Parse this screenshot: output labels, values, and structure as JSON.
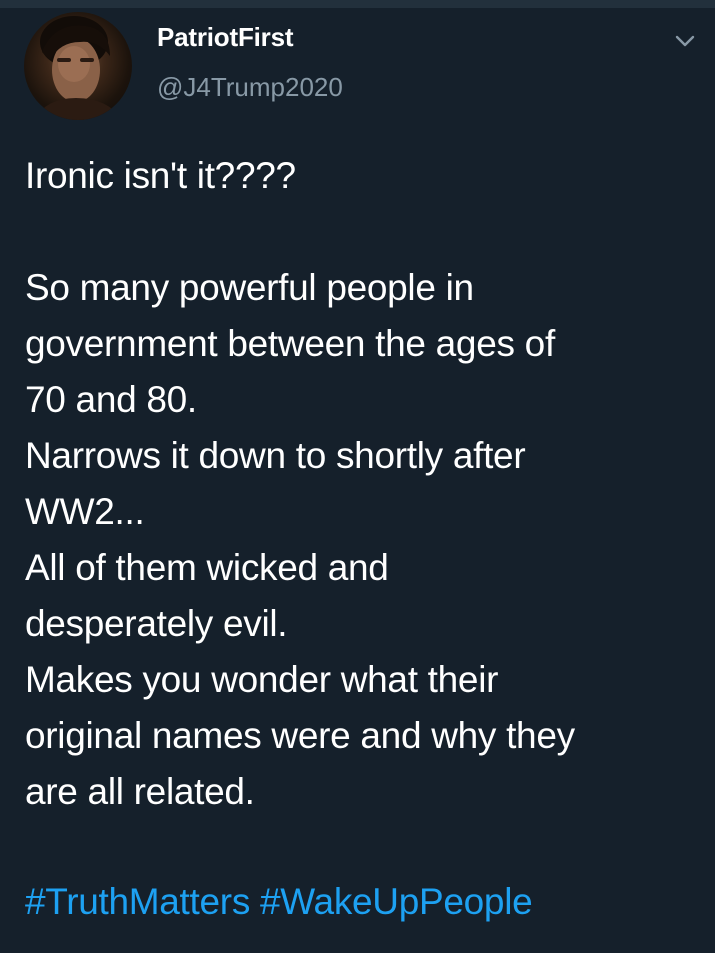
{
  "user": {
    "display_name": "PatriotFirst",
    "handle": "@J4Trump2020",
    "avatar_icon": "profile-photo"
  },
  "menu": {
    "icon": "chevron-down-icon"
  },
  "tweet": {
    "lines": [
      "Ironic isn't it????",
      "",
      "So many powerful people in",
      "government between the ages of",
      "70 and 80.",
      "Narrows it down to shortly after",
      "WW2...",
      "All of them wicked and",
      "desperately evil.",
      "Makes you wonder what their",
      "original names were and why they",
      "are all related.",
      ""
    ],
    "hashtags": [
      "#TruthMatters",
      "#WakeUpPeople"
    ]
  },
  "colors": {
    "background": "#15202b",
    "text": "#ffffff",
    "secondary_text": "#8899a6",
    "link": "#1da1f2"
  }
}
